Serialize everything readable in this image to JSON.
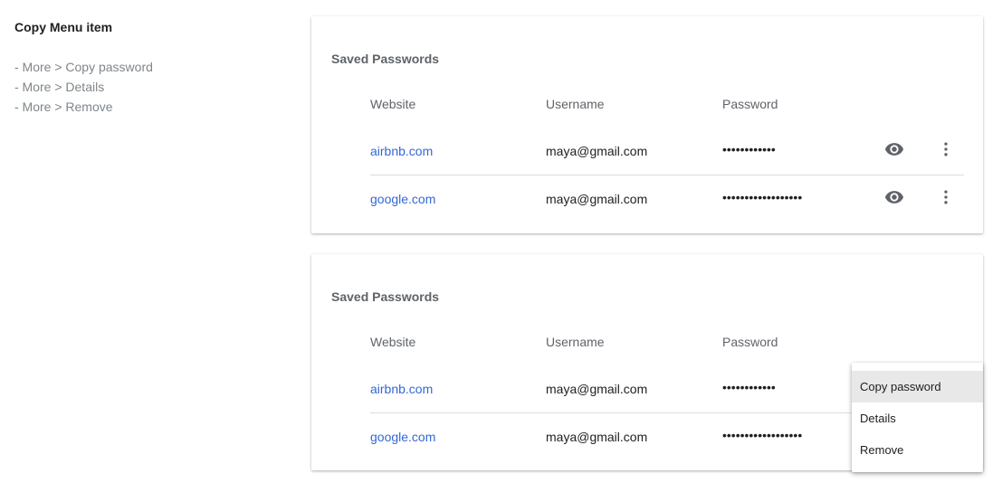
{
  "notes": {
    "title": "Copy Menu item",
    "items": [
      "- More > Copy password",
      "- More > Details",
      "- More > Remove"
    ]
  },
  "cards": [
    {
      "title": "Saved Passwords",
      "columns": {
        "website": "Website",
        "username": "Username",
        "password": "Password"
      },
      "rows": [
        {
          "website": "airbnb.com",
          "username": "maya@gmail.com",
          "password": "••••••••••••"
        },
        {
          "website": "google.com",
          "username": "maya@gmail.com",
          "password": "••••••••••••••••••"
        }
      ]
    },
    {
      "title": "Saved Passwords",
      "columns": {
        "website": "Website",
        "username": "Username",
        "password": "Password"
      },
      "rows": [
        {
          "website": "airbnb.com",
          "username": "maya@gmail.com",
          "password": "••••••••••••"
        },
        {
          "website": "google.com",
          "username": "maya@gmail.com",
          "password": "••••••••••••••••••"
        }
      ]
    }
  ],
  "menu": {
    "items": [
      "Copy password",
      "Details",
      "Remove"
    ],
    "highlighted": "Copy password"
  },
  "colors": {
    "link": "#3367d6",
    "icon": "#5f6368",
    "menu_highlight": "#e8e8e8"
  },
  "icons": {
    "show_password": "eye-icon",
    "more_actions": "more-vertical-icon"
  }
}
